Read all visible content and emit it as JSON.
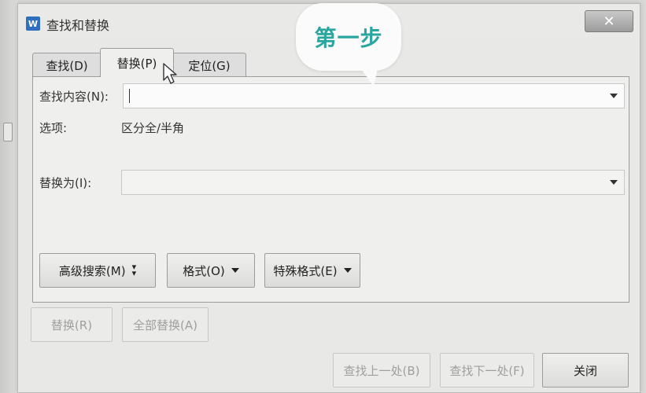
{
  "window": {
    "title": "查找和替换",
    "close_label": "✕"
  },
  "tabs": [
    {
      "label": "查找(D)",
      "selected": false
    },
    {
      "label": "替换(P)",
      "selected": true
    },
    {
      "label": "定位(G)",
      "selected": false
    }
  ],
  "find": {
    "label": "查找内容(N):",
    "value": ""
  },
  "options": {
    "label": "选项:",
    "value": "区分全/半角"
  },
  "replace": {
    "label": "替换为(I):",
    "value": ""
  },
  "format_buttons": {
    "advanced_search": "高级搜索(M)",
    "format": "格式(O)",
    "special_format": "特殊格式(E)"
  },
  "actions": {
    "replace": "替换(R)",
    "replace_all": "全部替换(A)",
    "find_prev": "查找上一处(B)",
    "find_next": "查找下一处(F)",
    "close": "关闭"
  },
  "annotation": {
    "text": "第一步"
  },
  "colors": {
    "annotation_text": "#2aa6a0",
    "app_icon": "#2f6fc0"
  },
  "icons": {
    "app": "wps-writer-icon",
    "close": "close-icon",
    "cursor": "mouse-pointer-icon"
  }
}
